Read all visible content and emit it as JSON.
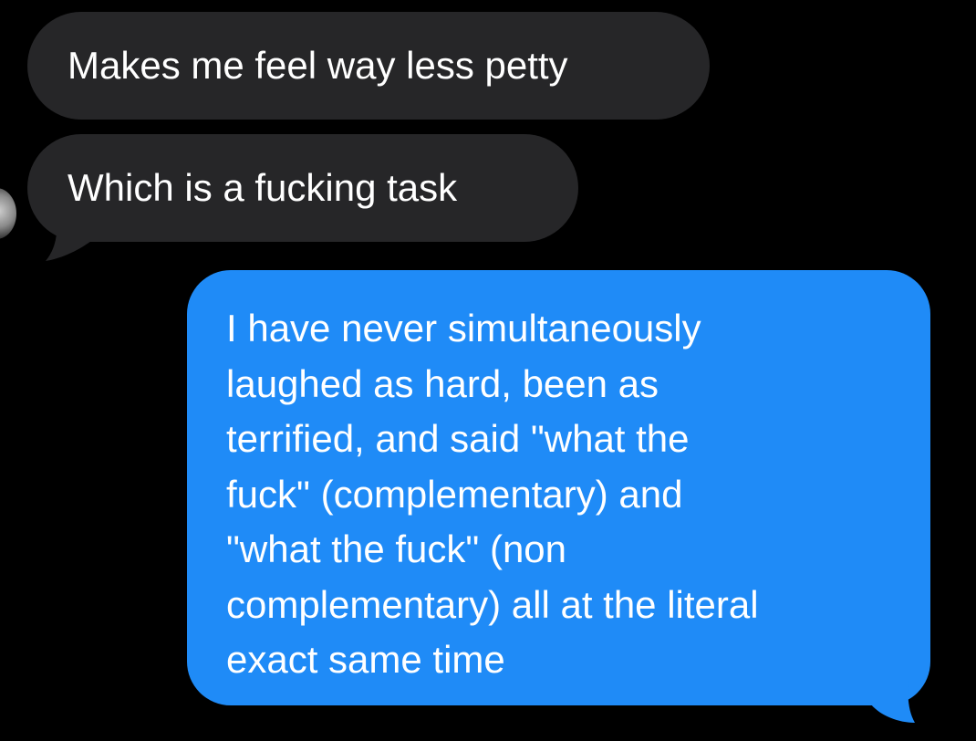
{
  "conversation": {
    "messages": [
      {
        "direction": "incoming",
        "text": "Makes me feel way less petty"
      },
      {
        "direction": "incoming",
        "text": "Which is a fucking task"
      },
      {
        "direction": "outgoing",
        "text": "I have never simultaneously\nlaughed as hard, been as\nterrified, and said \"what the\nfuck\" (complementary) and\n\"what the fuck\" (non\ncomplementary) all at the literal\nexact same time"
      }
    ]
  },
  "colors": {
    "background": "#000000",
    "incoming_bubble": "#262628",
    "outgoing_bubble": "#1f8bf7",
    "text": "#ffffff"
  },
  "icons": {
    "avatar": "contact-avatar"
  }
}
